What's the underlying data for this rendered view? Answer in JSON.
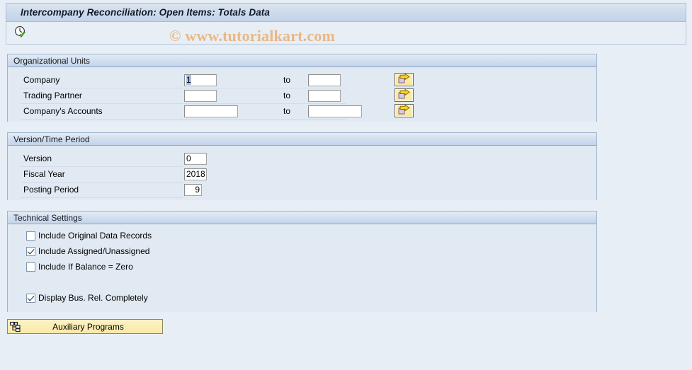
{
  "window": {
    "title": "Intercompany Reconciliation: Open Items: Totals Data"
  },
  "toolbar": {
    "execute_icon": "clock-check-icon",
    "execute_tooltip": "Execute"
  },
  "watermark": {
    "text": "© www.tutorialkart.com",
    "color": "#e8a96a"
  },
  "panels": [
    {
      "id": "org",
      "title": "Organizational Units"
    },
    {
      "id": "version",
      "title": "Version/Time Period"
    },
    {
      "id": "technical",
      "title": "Technical Settings"
    }
  ],
  "organizational_units": {
    "title": "Organizational Units",
    "to_label": "to",
    "multi_select_icon": "arrow-right-multi-select-icon",
    "rows": [
      {
        "label": "Company",
        "from_value": "1",
        "from_selected": true,
        "to_value": "",
        "has_multi_select": true
      },
      {
        "label": "Trading Partner",
        "from_value": "",
        "from_selected": false,
        "to_value": "",
        "has_multi_select": true
      },
      {
        "label": "Company's Accounts",
        "from_value": "",
        "from_selected": false,
        "to_value": "",
        "has_multi_select": true
      }
    ]
  },
  "version_time_period": {
    "title": "Version/Time Period",
    "rows": [
      {
        "label": "Version",
        "value": "0",
        "align": "left"
      },
      {
        "label": "Fiscal Year",
        "value": "2018",
        "align": "left"
      },
      {
        "label": "Posting Period",
        "value": "9",
        "align": "right"
      }
    ]
  },
  "technical_settings": {
    "title": "Technical Settings",
    "checkboxes": [
      {
        "label": "Include Original Data Records",
        "checked": false
      },
      {
        "label": "Include Assigned/Unassigned",
        "checked": true
      },
      {
        "label": "Include If Balance = Zero",
        "checked": false
      },
      {
        "label": "Display Bus. Rel. Completely",
        "checked": true
      }
    ]
  },
  "footer": {
    "auxiliary_programs_label": "Auxiliary Programs",
    "auxiliary_programs_icon": "hierarchy-tree-icon"
  }
}
